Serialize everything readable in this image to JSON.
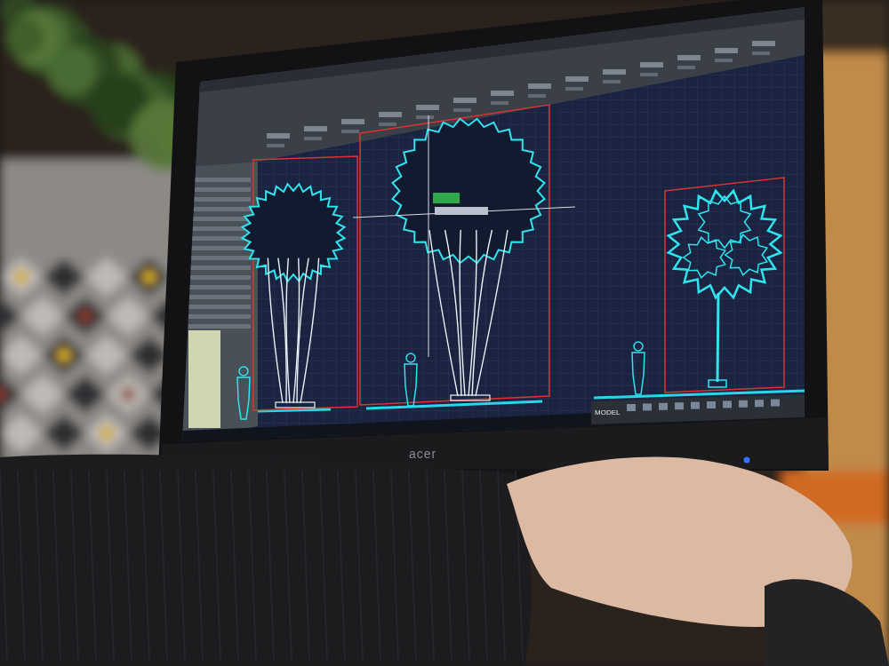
{
  "monitor": {
    "brand": "acer",
    "power_on": true
  },
  "cad": {
    "status_bar": {
      "mode": "MODEL"
    },
    "tree_elevations": [
      {
        "kind": "multi-stem",
        "selected": false
      },
      {
        "kind": "multi-stem",
        "selected": true
      },
      {
        "kind": "single-stem",
        "selected": false
      }
    ]
  }
}
